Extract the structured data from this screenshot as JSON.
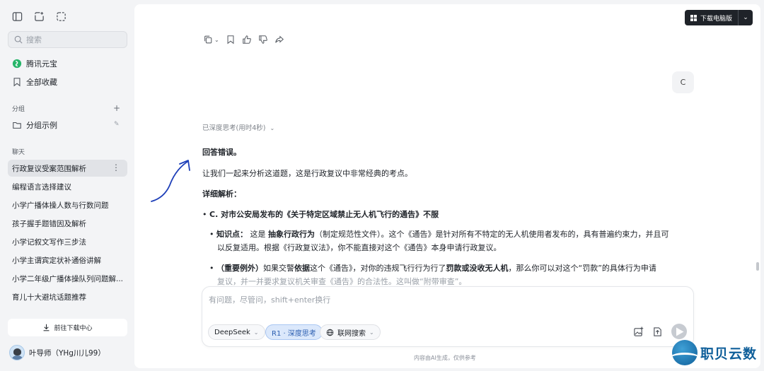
{
  "sidebar": {
    "search_placeholder": "搜索",
    "nav": {
      "yuanbao": "腾讯元宝",
      "favorites": "全部收藏"
    },
    "groups_label": "分组",
    "group_example": "分组示例",
    "chats_label": "聊天",
    "chats": [
      "行政复议受案范围解析",
      "编程语言选择建议",
      "小学广播体操人数与行数问题",
      "孩子握手题错因及解析",
      "小学记叙文写作三步法",
      "小学主谓宾定状补通俗讲解",
      "小学二年级广播体操队列问题解...",
      "育儿十大避坑话题推荐"
    ],
    "download_center": "前往下载中心",
    "user_name": "叶导师（YHg川儿99）"
  },
  "header": {
    "download_desktop": "下载电脑版"
  },
  "conversation": {
    "user_message": "C",
    "thinking_status": "已深度思考(用时4秒)",
    "answer": {
      "verdict": "回答错误。",
      "intro": "让我们一起来分析这道题，这是行政复议中非常经典的考点。",
      "detail_heading": "详细解析：",
      "point_c": "C. 对市公安局发布的《关于特定区域禁止无人机飞行的通告》不服",
      "knowledge_label": "知识点：",
      "knowledge_pre": " 这是 ",
      "knowledge_bold": "抽象行政行为",
      "knowledge_post": "（制定规范性文件）。这个《通告》是针对所有不特定的无人机使用者发布的，具有普遍约束力，并且可",
      "knowledge_line2": "以反复适用。根据《行政复议法》，你不能直接对这个《通告》本身申请行政复议。",
      "exception_label": "（重要例外）",
      "exception_pre": "如果交警",
      "exception_bold1": "依据",
      "exception_mid": "这个《通告》，对你的违规飞行行为",
      "exception_mid2": "行了",
      "exception_bold2": "罚款或没收无人机",
      "exception_post": "，那么你可以对这个“罚款”的具体行为申请",
      "exception_line2": "复议，并一并要求复议机关审查《通告》的合法性。这叫做“附带审查”。"
    }
  },
  "composer": {
    "placeholder": "有问题，尽管问，shift+enter换行",
    "model": "DeepSeek",
    "deep_think": "R1 · 深度思考",
    "web_search": "联网搜索"
  },
  "footer_note": "内容由AI生成，仅供参考",
  "watermark_text": "职贝云数",
  "colors": {
    "accent_blue": "#2a5db0",
    "annotation_arrow": "#1e3fb8",
    "watermark": "#0f5f9a"
  }
}
